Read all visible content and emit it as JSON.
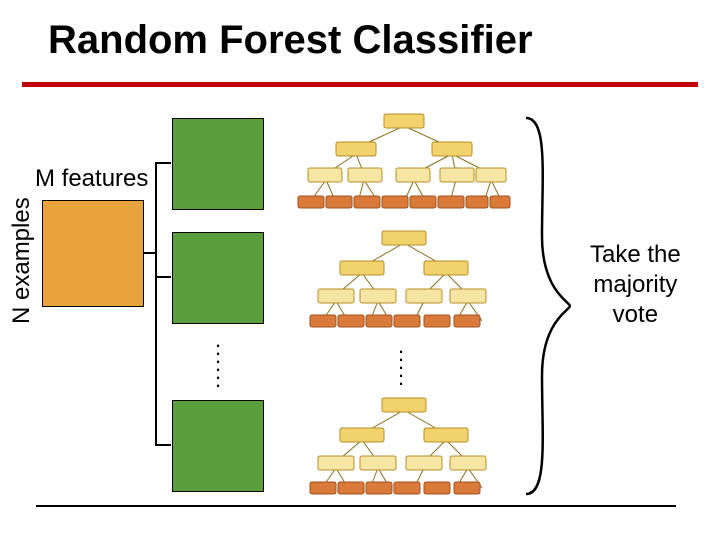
{
  "title": "Random Forest Classifier",
  "labels": {
    "m_features": "M features",
    "n_examples": "N examples",
    "vote_line1": "Take the",
    "vote_line2": "majority",
    "vote_line3": "vote"
  }
}
